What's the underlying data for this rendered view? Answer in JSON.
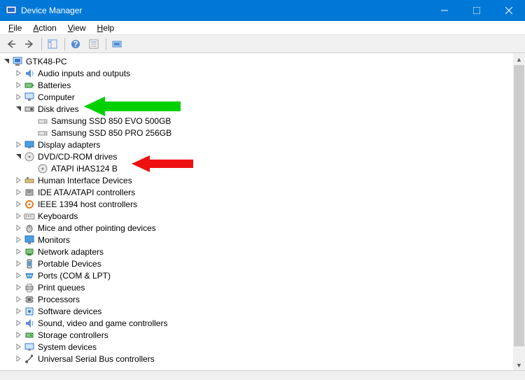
{
  "title": "Device Manager",
  "menu": {
    "file": "File",
    "action": "Action",
    "view": "View",
    "help": "Help"
  },
  "tree": {
    "root": "GTK48-PC",
    "audio": "Audio inputs and outputs",
    "batteries": "Batteries",
    "computer": "Computer",
    "diskdrives": "Disk drives",
    "ssd1": "Samsung SSD 850 EVO 500GB",
    "ssd2": "Samsung SSD 850 PRO 256GB",
    "display": "Display adapters",
    "dvd": "DVD/CD-ROM drives",
    "atapi": "ATAPI iHAS124   B",
    "hid": "Human Interface Devices",
    "ide": "IDE ATA/ATAPI controllers",
    "ieee": "IEEE 1394 host controllers",
    "keyboards": "Keyboards",
    "mice": "Mice and other pointing devices",
    "monitors": "Monitors",
    "network": "Network adapters",
    "portable": "Portable Devices",
    "ports": "Ports (COM & LPT)",
    "printq": "Print queues",
    "processors": "Processors",
    "software": "Software devices",
    "sound": "Sound, video and game controllers",
    "storage": "Storage controllers",
    "system": "System devices",
    "usb": "Universal Serial Bus controllers"
  }
}
